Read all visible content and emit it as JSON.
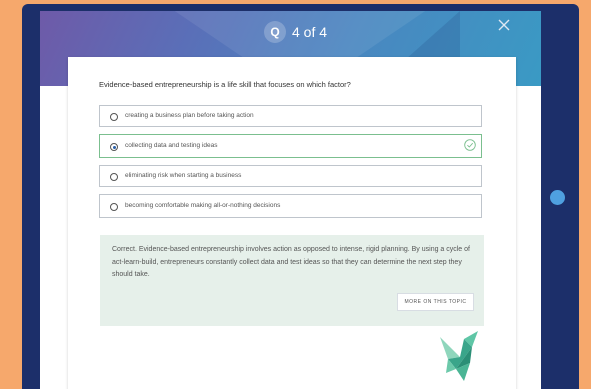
{
  "header": {
    "q_icon_letter": "Q",
    "counter": "4 of 4"
  },
  "question": "Evidence-based entrepreneurship is a life skill that focuses on which factor?",
  "options": [
    {
      "label": "creating a business plan before taking action",
      "selected": false
    },
    {
      "label": "collecting data and testing ideas",
      "selected": true
    },
    {
      "label": "eliminating risk when starting a business",
      "selected": false
    },
    {
      "label": "becoming comfortable making all-or-nothing decisions",
      "selected": false
    }
  ],
  "feedback": {
    "text": "Correct. Evidence-based entrepreneurship involves action as opposed to intense, rigid planning. By using a cycle of act-learn-build, entrepreneurs constantly collect data and test ideas so that they can determine the next step they should take.",
    "more_button": "MORE ON THIS TOPIC"
  },
  "colors": {
    "correct": "#7bbf8f",
    "feedback_bg": "#e6f0ea",
    "frame": "#1c2f6a",
    "bird": "#3aa58a"
  }
}
